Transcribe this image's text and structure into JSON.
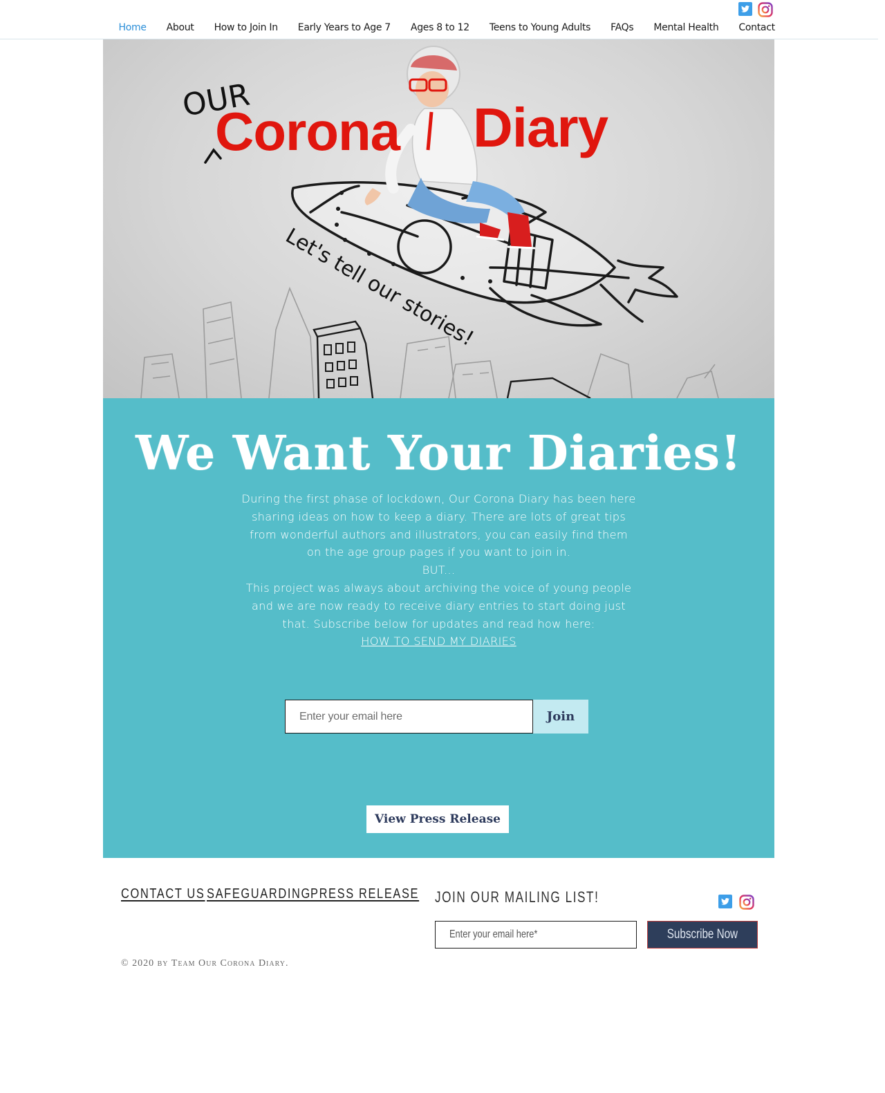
{
  "nav": {
    "items": [
      {
        "label": "Home",
        "active": true
      },
      {
        "label": "About"
      },
      {
        "label": "How to Join In"
      },
      {
        "label": "Early Years to Age 7"
      },
      {
        "label": "Ages 8 to 12"
      },
      {
        "label": "Teens to Young Adults"
      },
      {
        "label": "FAQs"
      },
      {
        "label": "Mental Health"
      },
      {
        "label": "Contact"
      }
    ]
  },
  "social": {
    "icons": [
      "twitter-icon",
      "instagram-icon"
    ],
    "twitter_color": "#3d9ee8",
    "instagram_color": "#d63a7a"
  },
  "hero": {
    "logo_our": "OUR",
    "logo_corona": "Corona",
    "logo_diary": "Diary",
    "tagline": "Let's tell our stories!",
    "brand_red": "#e0160e"
  },
  "main": {
    "headline": "We Want Your Diaries!",
    "paragraph1": "During the first phase of lockdown, Our Corona Diary has been here sharing ideas on how to keep a diary. There are lots of great tips from wonderful authors and illustrators, you can easily find them on the age group pages if you want to join in.",
    "but": "BUT...",
    "paragraph2": "This project was always about archiving the voice of young people and we are now ready to receive diary entries to start doing just that. Subscribe below for updates and read how here:",
    "how_link": "HOW TO SEND MY DIARIES",
    "email_placeholder": "Enter your email here",
    "join_label": "Join",
    "press_label": "View Press Release",
    "teal_color": "#55bdc9"
  },
  "footer": {
    "links": [
      "CONTACT US",
      "SAFEGUARDING",
      "PRESS RELEASE"
    ],
    "copyright": "© 2020 by Team Our Corona Diary.",
    "mailing_title": "JOIN OUR MAILING LIST!",
    "mail_placeholder": "Enter your email here*",
    "subscribe_label": "Subscribe Now"
  }
}
